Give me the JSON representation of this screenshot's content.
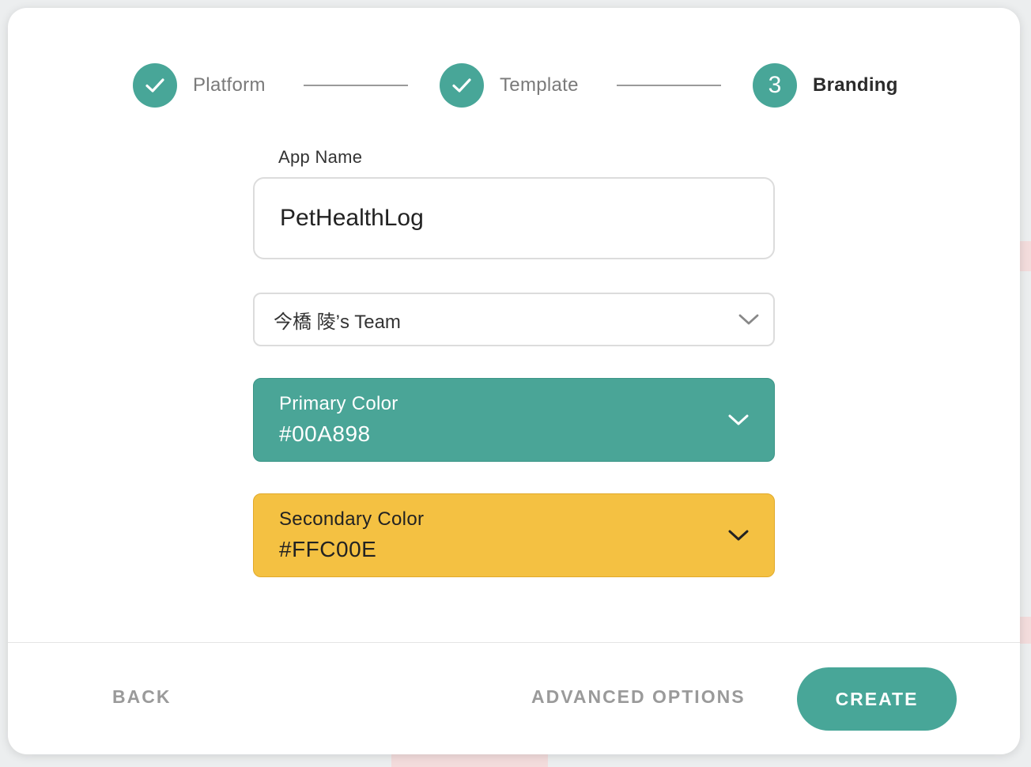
{
  "stepper": {
    "steps": [
      {
        "label": "Platform",
        "state": "complete",
        "icon": "check-icon"
      },
      {
        "label": "Template",
        "state": "complete",
        "icon": "check-icon"
      },
      {
        "label": "Branding",
        "state": "active",
        "number": "3"
      }
    ]
  },
  "form": {
    "app_name_label": "App Name",
    "app_name_value": "PetHealthLog",
    "team_select_value": "今橋 陵’s Team",
    "primary_color": {
      "label": "Primary Color",
      "value": "#00A898",
      "swatch": "#4aa597"
    },
    "secondary_color": {
      "label": "Secondary Color",
      "value": "#FFC00E",
      "swatch": "#f4c142"
    }
  },
  "footer": {
    "back_label": "BACK",
    "advanced_label": "ADVANCED OPTIONS",
    "create_label": "CREATE"
  },
  "colors": {
    "accent": "#48a698",
    "secondary": "#f4c142"
  }
}
